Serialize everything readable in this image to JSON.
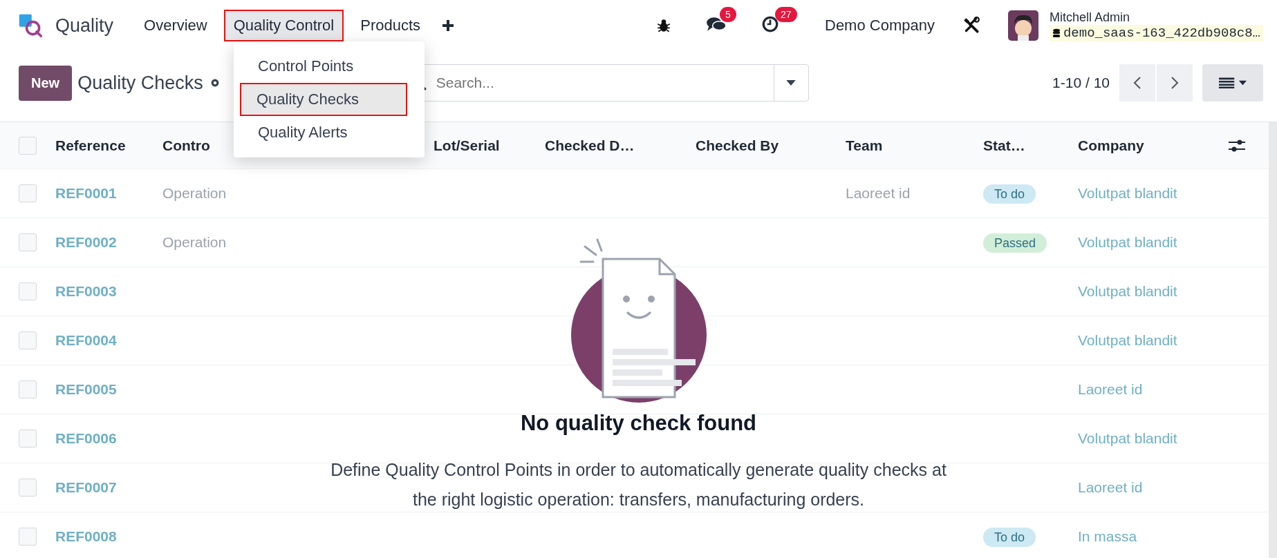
{
  "navbar": {
    "app_name": "Quality",
    "menus": [
      {
        "label": "Overview",
        "selected": false
      },
      {
        "label": "Quality Control",
        "selected": true
      },
      {
        "label": "Products",
        "selected": false
      }
    ],
    "chat_count": "5",
    "activity_count": "27",
    "company": "Demo Company",
    "user": {
      "name": "Mitchell Admin",
      "database": "demo_saas-163_422db908c8…"
    }
  },
  "dropdown": {
    "items": [
      {
        "label": "Control Points",
        "selected": false
      },
      {
        "label": "Quality Checks",
        "selected": true
      },
      {
        "label": "Quality Alerts",
        "selected": false
      }
    ]
  },
  "control_panel": {
    "new_button": "New",
    "title": "Quality Checks",
    "search": {
      "placeholder": "Search..."
    },
    "pager": "1-10 / 10"
  },
  "table": {
    "select_all_checked": false,
    "columns": [
      "Reference",
      "Contro",
      "Lot/Serial",
      "Checked D…",
      "Checked By",
      "Team",
      "Stat…",
      "Company"
    ],
    "rows": [
      {
        "checked": false,
        "reference": "REF0001",
        "control_point": "Operation",
        "team": "Laoreet id",
        "status": "To do",
        "color": "#cde9f3",
        "company": "Volutpat blandit"
      },
      {
        "checked": false,
        "reference": "REF0002",
        "control_point": "Operation",
        "status": "Passed",
        "color": "#d2eed8",
        "company": "Volutpat blandit"
      },
      {
        "checked": false,
        "reference": "REF0003",
        "company": "Volutpat blandit"
      },
      {
        "checked": false,
        "reference": "REF0004",
        "company": "Volutpat blandit"
      },
      {
        "checked": false,
        "reference": "REF0005",
        "company": "Laoreet id"
      },
      {
        "checked": false,
        "reference": "REF0006",
        "company": "Volutpat blandit"
      },
      {
        "checked": false,
        "reference": "REF0007",
        "company": "Laoreet id"
      },
      {
        "checked": false,
        "reference": "REF0008",
        "status": "To do",
        "color": "#cde9f3",
        "company": "In massa"
      }
    ]
  },
  "empty_state": {
    "title": "No quality check found",
    "description": "Define Quality Control Points in order to automatically generate quality checks at the right logistic operation: transfers, manufacturing orders."
  }
}
